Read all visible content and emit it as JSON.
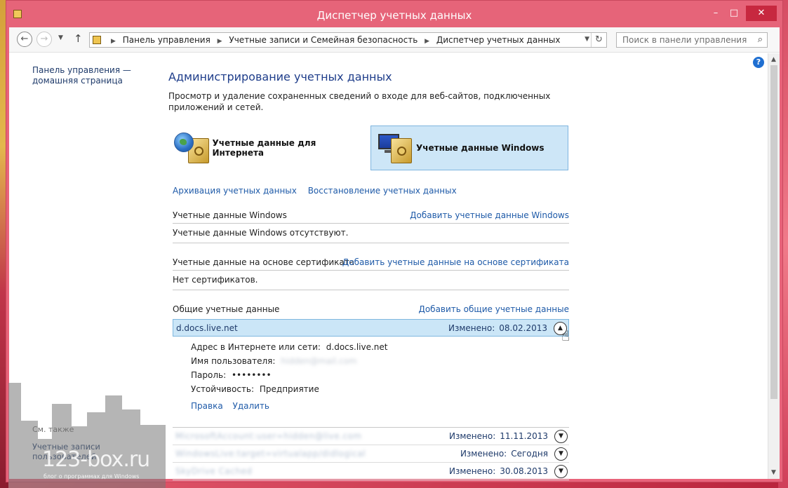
{
  "window": {
    "title": "Диспетчер учетных данных",
    "controls": {
      "minimize": "–",
      "maximize": "□",
      "close": "✕"
    }
  },
  "navigation": {
    "breadcrumbs": [
      "Панель управления",
      "Учетные записи и Семейная безопасность",
      "Диспетчер учетных данных"
    ],
    "search_placeholder": "Поиск в панели управления"
  },
  "sidebar": {
    "home_link": "Панель управления — домашняя страница",
    "see_also": "См. также",
    "see_also_link": "Учетные записи пользователей"
  },
  "main": {
    "title": "Администрирование учетных данных",
    "description": "Просмотр и удаление сохраненных сведений о входе для веб-сайтов, подключенных приложений и сетей.",
    "categories": [
      {
        "label": "Учетные данные для Интернета",
        "icon": "globe-safe-icon",
        "selected": false
      },
      {
        "label": "Учетные данные Windows",
        "icon": "monitor-safe-icon",
        "selected": true
      }
    ],
    "links": {
      "backup": "Архивация учетных данных",
      "restore": "Восстановление учетных данных"
    },
    "sections": {
      "windows": {
        "title": "Учетные данные Windows",
        "add": "Добавить учетные данные Windows",
        "empty": "Учетные данные Windows отсутствуют."
      },
      "certificate": {
        "title": "Учетные данные на основе сертификата",
        "add": "Добавить учетные данные на основе сертификата",
        "empty": "Нет сертификатов."
      },
      "generic": {
        "title": "Общие учетные данные",
        "add": "Добавить общие учетные данные",
        "expanded": {
          "name": "d.docs.live.net",
          "modified_label": "Изменено:",
          "modified_date": "08.02.2013",
          "address_label": "Адрес в Интернете или сети:",
          "address_value": "d.docs.live.net",
          "user_label": "Имя пользователя:",
          "user_value": "hidden@mail.com",
          "password_label": "Пароль:",
          "password_value": "••••••••",
          "persistence_label": "Устойчивость:",
          "persistence_value": "Предприятие",
          "edit": "Правка",
          "delete": "Удалить"
        },
        "entries": [
          {
            "name": "MicrosoftAccount:user=hidden@live.com",
            "modified_label": "Изменено:",
            "modified_date": "11.11.2013"
          },
          {
            "name": "WindowsLive:target=virtualapp/didlogical",
            "modified_label": "Изменено:",
            "modified_date": "Сегодня"
          },
          {
            "name": "SkyDrive Cached",
            "modified_label": "Изменено:",
            "modified_date": "30.08.2013"
          }
        ]
      }
    }
  },
  "watermark": {
    "text": "123-box.ru",
    "subtitle": "блог о программах для Windows"
  }
}
